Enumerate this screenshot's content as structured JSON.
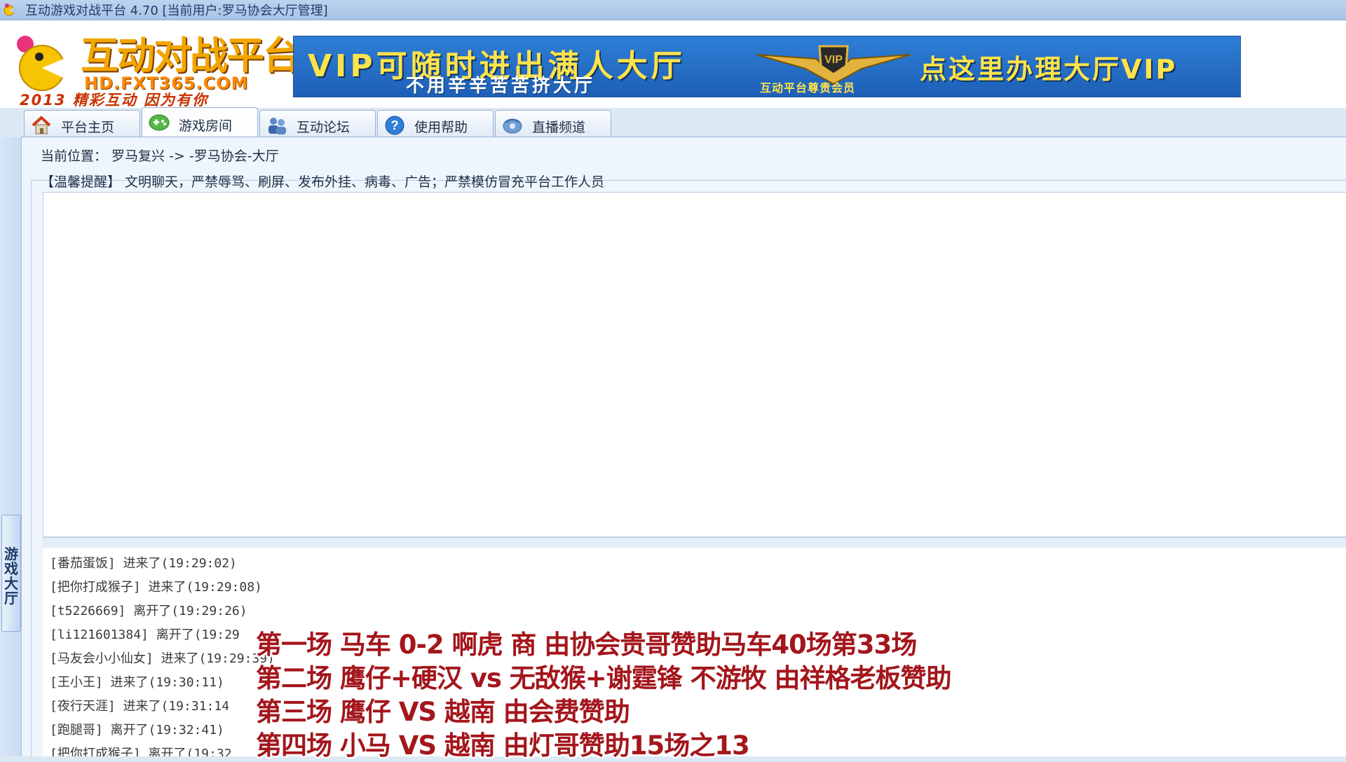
{
  "window": {
    "title": "互动游戏对战平台 4.70 [当前用户:罗马协会大厅管理]"
  },
  "logo": {
    "name": "互动对战平台",
    "url": "HD.FXT365.COM",
    "slogan": "2013 精彩互动 因为有你"
  },
  "banner": {
    "line1": "VIP可随时进出满人大厅",
    "line2": "不用辛辛苦苦挤大厅",
    "badge": "VIP",
    "badge_caption": "互动平台尊贵会员",
    "line3": "点这里办理大厅VIP"
  },
  "tabs": [
    {
      "label": "平台主页",
      "icon": "home-icon",
      "active": false
    },
    {
      "label": "游戏房间",
      "icon": "gamepad-icon",
      "active": true
    },
    {
      "label": "互动论坛",
      "icon": "users-icon",
      "active": false
    },
    {
      "label": "使用帮助",
      "icon": "help-icon",
      "active": false
    },
    {
      "label": "直播频道",
      "icon": "broadcast-icon",
      "active": false
    }
  ],
  "sidebar": {
    "lobby_tab": "游戏大厅"
  },
  "breadcrumb": "当前位置： 罗马复兴 -> -罗马协会-大厅",
  "notice": "【温馨提醒】 文明聊天，严禁辱骂、刷屏、发布外挂、病毒、广告；严禁模仿冒充平台工作人员",
  "log": [
    "[番茄蛋饭] 进来了(19:29:02)",
    "[把你打成猴子] 进来了(19:29:08)",
    "[t5226669] 离开了(19:29:26)",
    "[li121601384] 离开了(19:29",
    "[马友会小小仙女] 进来了(19:29:39)",
    "[王小王] 进来了(19:30:11)",
    "[夜行天涯] 进来了(19:31:14",
    "[跑腿哥] 离开了(19:32:41)",
    "[把你打成猴子] 离开了(19:32"
  ],
  "overlay": [
    "第一场  马车 0-2 啊虎  商  由协会贵哥赞助马车40场第33场",
    "第二场 鹰仔+硬汉 vs 无敌猴+谢霆锋     不游牧  由祥格老板赞助",
    "第三场 鹰仔 VS 越南      由会费赞助",
    "第四场 小马 VS 越南    由灯哥赞助15场之13"
  ],
  "colors": {
    "overlay_text": "#a3161c",
    "banner_bg": "#2f7fd6",
    "banner_text": "#ffe34a"
  }
}
